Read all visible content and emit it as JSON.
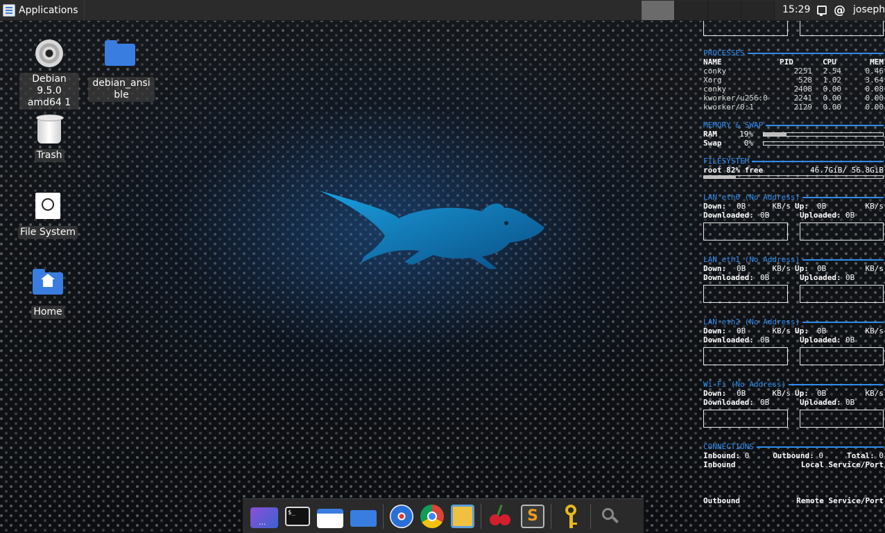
{
  "panel": {
    "apps_label": "Applications",
    "clock": "15:29",
    "user": "joseph",
    "debian_glyph": "@"
  },
  "desktop": {
    "icons": [
      {
        "label": "Debian 9.5.0 amd64 1",
        "icon": "optical-disc-icon"
      },
      {
        "label": "debian_ansible",
        "icon": "folder-icon"
      },
      {
        "label": "Trash",
        "icon": "trash-icon"
      },
      {
        "label": "File System",
        "icon": "drive-icon"
      },
      {
        "label": "Home",
        "icon": "home-folder-icon"
      }
    ]
  },
  "conky": {
    "processes": {
      "title": "PROCESSES",
      "headers": [
        "NAME",
        "PID",
        "CPU",
        "MEM"
      ],
      "rows": [
        [
          "conky",
          "2251",
          "2.54",
          "0.46"
        ],
        [
          "Xorg",
          "528",
          "1.02",
          "3.64"
        ],
        [
          "conky",
          "2408",
          "0.00",
          "0.08"
        ],
        [
          "kworker/u256:0",
          "2241",
          "0.00",
          "0.00"
        ],
        [
          "kworker/0:1",
          "2129",
          "0.00",
          "0.00"
        ]
      ]
    },
    "memory": {
      "title": "MEMORY & SWAP",
      "ram_label": "RAM",
      "ram_pct": "19%",
      "ram_fraction": 0.19,
      "swap_label": "Swap",
      "swap_pct": "0%",
      "swap_fraction": 0.0
    },
    "filesystem": {
      "title": "FILESYSTEM",
      "root_text": "root 82% free",
      "usage_text": "46.7GiB/ 56.8GiB",
      "used_fraction": 0.18
    },
    "networks": [
      {
        "title": "LAN eth0 (No Address)",
        "down_val": "0B",
        "down_unit": "KB/s",
        "up_val": "0B",
        "up_unit": "KB/s",
        "downloaded": "0B",
        "uploaded": "0B"
      },
      {
        "title": "LAN eth1 (No Address)",
        "down_val": "0B",
        "down_unit": "KB/s",
        "up_val": "0B",
        "up_unit": "KB/s",
        "downloaded": "0B",
        "uploaded": "0B"
      },
      {
        "title": "LAN eth2 (No Address)",
        "down_val": "0B",
        "down_unit": "KB/s",
        "up_val": "0B",
        "up_unit": "KB/s",
        "downloaded": "0B",
        "uploaded": "0B"
      },
      {
        "title": "Wi-Fi (No Address)",
        "down_val": "0B",
        "down_unit": "KB/s",
        "up_val": "0B",
        "up_unit": "KB/s",
        "downloaded": "0B",
        "uploaded": "0B"
      }
    ],
    "labels": {
      "down": "Down:",
      "up": "Up:",
      "downloaded": "Downloaded:",
      "uploaded": "Uploaded:"
    },
    "connections": {
      "title": "CONNECTIONS",
      "inbound_label": "Inbound:",
      "inbound": "0",
      "outbound_label": "Outbound:",
      "outbound": "0",
      "total_label": "Total:",
      "total": "0",
      "inbound_col": "Inbound",
      "local_col": "Local Service/Port",
      "outbound_col": "Outbound",
      "remote_col": "Remote Service/Port"
    }
  },
  "dock": {
    "items": [
      "show-desktop-icon",
      "terminal-icon",
      "file-manager-icon",
      "folder-icon",
      "web-browser-icon",
      "chrome-icon",
      "virtualbox-icon",
      "cherrytree-icon",
      "sublime-text-icon",
      "keyring-icon",
      "app-finder-icon"
    ],
    "terminal_glyph": "$_",
    "sublime_glyph": "S"
  },
  "colors": {
    "accent": "#2f8df0",
    "panel": "#2b2b2b"
  }
}
